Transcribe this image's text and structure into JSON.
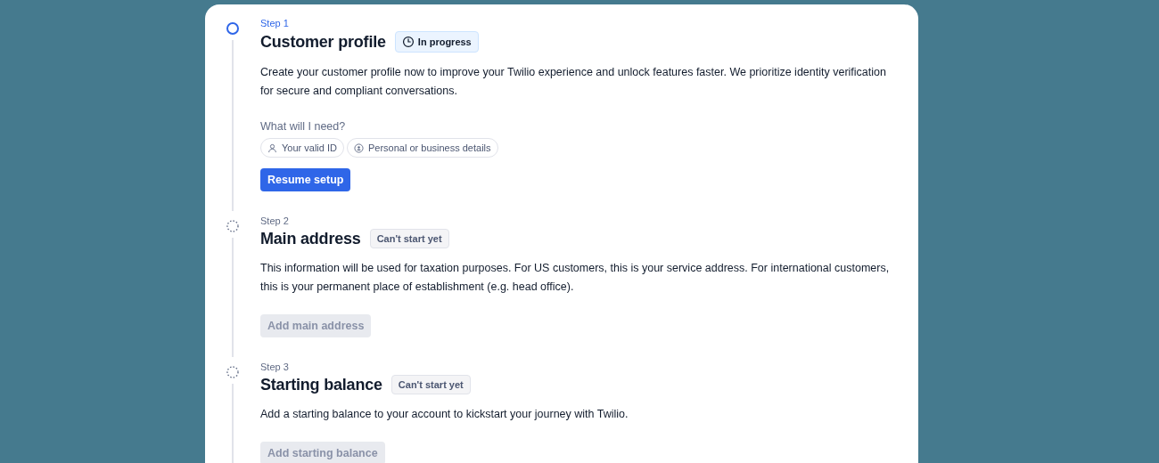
{
  "steps": [
    {
      "step_label": "Step 1",
      "title": "Customer profile",
      "status": {
        "kind": "in_progress",
        "label": "In progress"
      },
      "description": "Create your customer profile now to improve your Twilio experience and unlock features faster. We prioritize identity verification for secure and compliant conversations.",
      "requirements": {
        "heading": "What will I need?",
        "items": [
          {
            "kind": "person",
            "label": "Your valid ID"
          },
          {
            "kind": "badge",
            "label": "Personal or business details"
          }
        ]
      },
      "button": {
        "label": "Resume setup",
        "disabled": false
      }
    },
    {
      "step_label": "Step 2",
      "title": "Main address",
      "status": {
        "kind": "blocked",
        "label": "Can't start yet"
      },
      "description": "This information will be used for taxation purposes. For US customers, this is your service address. For international customers, this is your permanent place of establishment (e.g. head office).",
      "button": {
        "label": "Add main address",
        "disabled": true
      }
    },
    {
      "step_label": "Step 3",
      "title": "Starting balance",
      "status": {
        "kind": "blocked",
        "label": "Can't start yet"
      },
      "description": "Add a starting balance to your account to kickstart your journey with Twilio.",
      "button": {
        "label": "Add starting balance",
        "disabled": true
      }
    }
  ]
}
